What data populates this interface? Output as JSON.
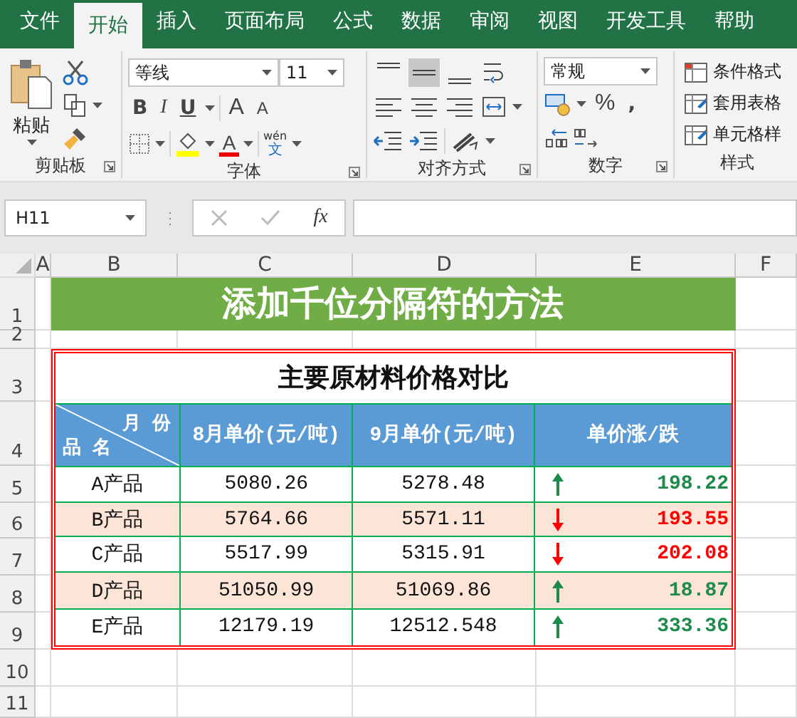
{
  "tabs": [
    {
      "label": "文件",
      "selected": false
    },
    {
      "label": "开始",
      "selected": true
    },
    {
      "label": "插入",
      "selected": false
    },
    {
      "label": "页面布局",
      "selected": false
    },
    {
      "label": "公式",
      "selected": false
    },
    {
      "label": "数据",
      "selected": false
    },
    {
      "label": "审阅",
      "selected": false
    },
    {
      "label": "视图",
      "selected": false
    },
    {
      "label": "开发工具",
      "selected": false
    },
    {
      "label": "帮助",
      "selected": false
    }
  ],
  "clipboard": {
    "paste_label": "粘贴",
    "group_label": "剪贴板"
  },
  "font": {
    "font_name": "等线",
    "font_size": "11",
    "style_buttons": [
      "B",
      "I",
      "U"
    ],
    "grow_label": "A",
    "shrink_label": "A",
    "font_color_label": "A",
    "phonetic_top": "wén",
    "phonetic_bottom": "文",
    "group_label": "字体"
  },
  "alignment": {
    "group_label": "对齐方式"
  },
  "number": {
    "format": "常规",
    "percent": "%",
    "comma": ",",
    "group_label": "数字"
  },
  "styles": {
    "items": [
      "条件格式",
      "套用表格",
      "单元格样"
    ],
    "group_label": "样式"
  },
  "formula_bar": {
    "name_box": "H11",
    "function_label": "fx"
  },
  "sheet": {
    "columns": [
      "A",
      "B",
      "C",
      "D",
      "E",
      "F"
    ],
    "rows": [
      "1",
      "2",
      "3",
      "4",
      "5",
      "6",
      "7",
      "8",
      "9",
      "10",
      "11"
    ],
    "title": "添加千位分隔符的方法",
    "table": {
      "title": "主要原材料价格对比",
      "corner_top": "月 份",
      "corner_bottom": "品 名",
      "columns": [
        "8月单价(元/吨)",
        "9月单价(元/吨)",
        "单价涨/跌"
      ],
      "rows": [
        {
          "product": "A产品",
          "august": "5080.26",
          "september": "5278.48",
          "kind": "up",
          "change": "198.22",
          "highlighted": false
        },
        {
          "product": "B产品",
          "august": "5764.66",
          "september": "5571.11",
          "kind": "down",
          "change": "193.55",
          "highlighted": true
        },
        {
          "product": "C产品",
          "august": "5517.99",
          "september": "5315.91",
          "kind": "down",
          "change": "202.08",
          "highlighted": false
        },
        {
          "product": "D产品",
          "august": "51050.99",
          "september": "51069.86",
          "kind": "up",
          "change": "18.87",
          "highlighted": true
        },
        {
          "product": "E产品",
          "august": "12179.19",
          "september": "12512.548",
          "kind": "up",
          "change": "333.36",
          "highlighted": false
        }
      ]
    }
  }
}
